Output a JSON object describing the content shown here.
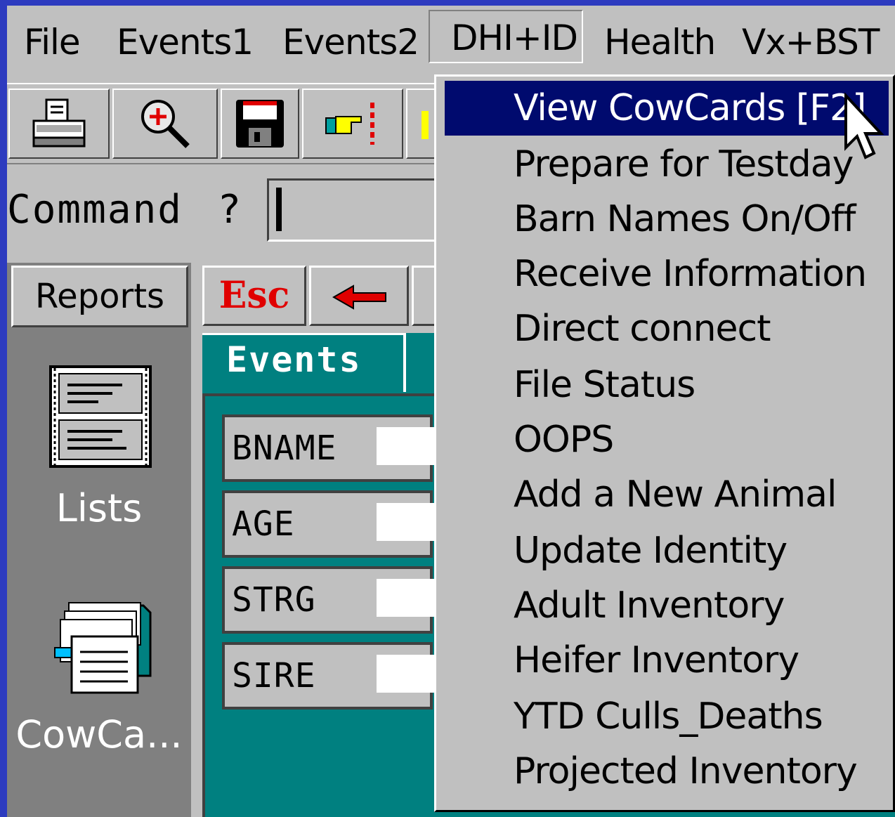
{
  "menubar": {
    "items": [
      {
        "label": "File"
      },
      {
        "label": "Events1"
      },
      {
        "label": "Events2"
      },
      {
        "label": "DHI+ID"
      },
      {
        "label": "Health"
      },
      {
        "label": "Vx+BST"
      }
    ]
  },
  "toolbar": {
    "icons": [
      "printer-icon",
      "zoom-icon",
      "save-icon",
      "pointing-hand-icon"
    ]
  },
  "command": {
    "label": "Command",
    "prompt": "?",
    "value": ""
  },
  "leftpanel": {
    "reports_label": "Reports",
    "lists_label": "Lists",
    "cowcards_label": "CowCa..."
  },
  "content": {
    "esc_label": "Esc",
    "tab_label": "Events",
    "fields": [
      {
        "name": "BNAME",
        "value": ""
      },
      {
        "name": "AGE",
        "value": ""
      },
      {
        "name": "STRG",
        "value": ""
      },
      {
        "name": "SIRE",
        "value": ""
      }
    ]
  },
  "dropdown": {
    "items": [
      {
        "label": "View CowCards [F2]"
      },
      {
        "label": "Prepare for Testday"
      },
      {
        "label": "Barn Names On/Off"
      },
      {
        "label": "Receive Information"
      },
      {
        "label": "Direct connect"
      },
      {
        "label": "File Status"
      },
      {
        "label": "OOPS"
      },
      {
        "label": "Add a New Animal"
      },
      {
        "label": "Update Identity"
      },
      {
        "label": "Adult Inventory"
      },
      {
        "label": "Heifer Inventory"
      },
      {
        "label": "YTD Culls_Deaths"
      },
      {
        "label": "Projected Inventory"
      }
    ],
    "selected": "View CowCards [F2]"
  },
  "colors": {
    "desktop": "#2d3bbf",
    "window_face": "#c0c0c0",
    "teal": "#008080",
    "selection": "#000a6e",
    "esc_red": "#e00000"
  }
}
